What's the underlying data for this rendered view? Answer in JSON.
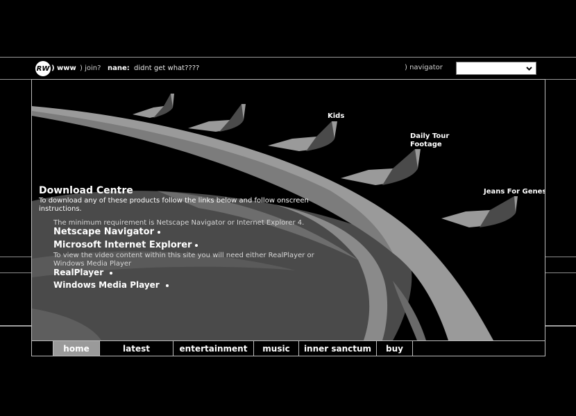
{
  "header": {
    "logo_text": "RW",
    "www_label": ") www",
    "join_label": ") join?",
    "chat_user": "nane:",
    "chat_message": "didnt get what????",
    "navigator_label": ") navigator",
    "navigator_selected": ""
  },
  "hotspots": {
    "kids": "Kids",
    "daily_tour": "Daily Tour Footage",
    "jeans": "Jeans For Genes"
  },
  "download_centre": {
    "title": "Download Centre",
    "intro": "To download any of these products follow the links below and follow onscreen instructions.",
    "minimum": "The minimum requirement is Netscape Navigator or Internet Explorer 4.",
    "netscape": "Netscape Navigator",
    "ie": "Microsoft Internet Explorer",
    "video_note": "To view the video content within this site you will need either RealPlayer or Windows Media Player",
    "realplayer": "RealPlayer",
    "wmp": "Windows Media Player"
  },
  "tabs": {
    "home": "home",
    "latest": "latest",
    "entertainment": "entertainment",
    "music": "music",
    "inner_sanctum": "inner sanctum",
    "buy": "buy",
    "active": "home"
  },
  "colors": {
    "background": "#000000",
    "art_grey": "#9a9a9a",
    "art_dark": "#4a4a4a",
    "text": "#ffffff"
  }
}
